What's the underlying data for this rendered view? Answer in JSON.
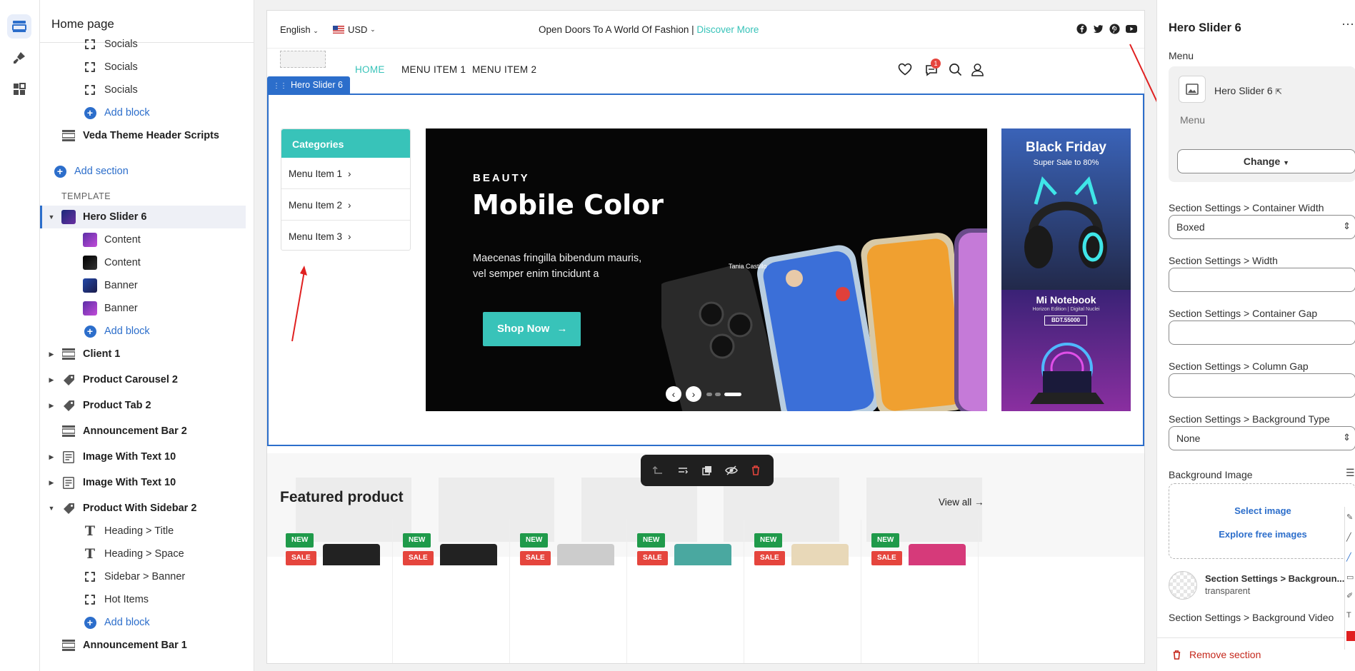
{
  "left_panel": {
    "title": "Home page",
    "template_label": "TEMPLATE",
    "rows": [
      {
        "label": "Socials",
        "kind": "dash",
        "indent": 2
      },
      {
        "label": "Socials",
        "kind": "dash",
        "indent": 2
      },
      {
        "label": "Socials",
        "kind": "dash",
        "indent": 2
      },
      {
        "label": "Add block",
        "kind": "add",
        "indent": 2
      },
      {
        "label": "Veda Theme Header Scripts",
        "kind": "section-strip",
        "indent": 1
      },
      {
        "label": "Add section",
        "kind": "add",
        "indent": 0
      },
      {
        "label": "Hero Slider 6",
        "kind": "thumb-dark",
        "indent": 1,
        "expanded": true,
        "selected": true
      },
      {
        "label": "Content",
        "kind": "thumb-purple",
        "indent": 2
      },
      {
        "label": "Content",
        "kind": "thumb-black",
        "indent": 2
      },
      {
        "label": "Banner",
        "kind": "thumb-blue",
        "indent": 2
      },
      {
        "label": "Banner",
        "kind": "thumb-purple",
        "indent": 2
      },
      {
        "label": "Add block",
        "kind": "add",
        "indent": 2
      },
      {
        "label": "Client 1",
        "kind": "section-strip",
        "indent": 1,
        "collapsed": true
      },
      {
        "label": "Product Carousel 2",
        "kind": "tag",
        "indent": 1,
        "collapsed": true
      },
      {
        "label": "Product Tab 2",
        "kind": "tag",
        "indent": 1,
        "collapsed": true
      },
      {
        "label": "Announcement Bar 2",
        "kind": "section-strip",
        "indent": 1
      },
      {
        "label": "Image With Text 10",
        "kind": "doc",
        "indent": 1,
        "collapsed": true
      },
      {
        "label": "Image With Text 10",
        "kind": "doc",
        "indent": 1,
        "collapsed": true
      },
      {
        "label": "Product With Sidebar 2",
        "kind": "tag",
        "indent": 1,
        "expanded": true
      },
      {
        "label": "Heading > Title",
        "kind": "text",
        "indent": 2
      },
      {
        "label": "Heading > Space",
        "kind": "text",
        "indent": 2
      },
      {
        "label": "Sidebar > Banner",
        "kind": "dash",
        "indent": 2
      },
      {
        "label": "Hot Items",
        "kind": "dash",
        "indent": 2
      },
      {
        "label": "Add block",
        "kind": "add",
        "indent": 2
      },
      {
        "label": "Announcement Bar 1",
        "kind": "section-strip",
        "indent": 1
      }
    ]
  },
  "store": {
    "language": "English",
    "currency": "USD",
    "announcement": "Open Doors To A World Of Fashion |",
    "announcement_link": "Discover More",
    "nav": [
      "HOME",
      "MENU ITEM 1",
      "MENU ITEM 2"
    ],
    "cart_count": "1",
    "section_tag": "Hero Slider 6",
    "categories_title": "Categories",
    "categories": [
      "Menu Item 1",
      "Menu Item 2",
      "Menu Item 3"
    ],
    "slide": {
      "eyebrow": "BEAUTY",
      "title": "Mobile Color",
      "text_line1": "Maecenas fringilla bibendum mauris,",
      "text_line2": "vel semper enim tincidunt a",
      "button": "Shop Now",
      "caller_name": "Tania Castillo"
    },
    "banner_top": {
      "title": "Black Friday",
      "subtitle": "Super Sale to 80%"
    },
    "banner_bottom": {
      "title": "Mi Notebook",
      "subtitle": "Horizon Edition | Digital Nuclei",
      "price": "BDT.55000"
    },
    "featured_title": "Featured product",
    "view_all": "View all",
    "badge_new": "NEW",
    "badge_sale": "SALE",
    "accent": "#38c3b9"
  },
  "right_panel": {
    "title": "Hero Slider 6",
    "menu_label": "Menu",
    "menu_item_name": "Hero Slider 6",
    "menu_sub": "Menu",
    "change_button": "Change",
    "container_width_label": "Section Settings > Container Width",
    "container_width_value": "Boxed",
    "width_label": "Section Settings > Width",
    "container_gap_label": "Section Settings > Container Gap",
    "column_gap_label": "Section Settings > Column Gap",
    "bg_type_label": "Section Settings > Background Type",
    "bg_type_value": "None",
    "bg_image_label": "Background Image",
    "select_image": "Select image",
    "explore_images": "Explore free images",
    "bg_color_label": "Section Settings > Backgroun...",
    "bg_color_value": "transparent",
    "bg_video_label": "Section Settings > Background Video",
    "remove_section": "Remove section"
  }
}
